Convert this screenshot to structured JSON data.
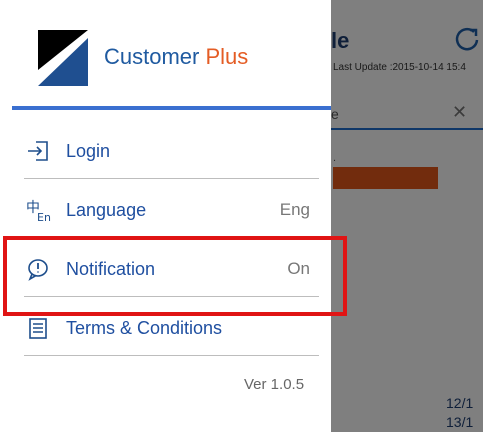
{
  "background": {
    "title": "le",
    "refresh_icon": "refresh-icon",
    "last_update": "Last Update :2015-10-14 15:4",
    "search_placeholder": "e",
    "close_icon": "close-icon",
    "dot_text": ".",
    "dates": [
      "12/1",
      "13/1"
    ]
  },
  "drawer": {
    "brand_name": "Customer ",
    "brand_plus": "Plus",
    "menu": [
      {
        "label": "Login",
        "icon": "login-icon",
        "value": ""
      },
      {
        "label": "Language",
        "icon": "language-icon",
        "value": "Eng"
      },
      {
        "label": "Notification",
        "icon": "notification-icon",
        "value": "On"
      },
      {
        "label": "Terms & Conditions",
        "icon": "document-icon",
        "value": ""
      }
    ],
    "version": "Ver 1.0.5"
  },
  "colors": {
    "brand_blue": "#1f5aa0",
    "brand_orange": "#e45c24",
    "highlight_red": "#e01414"
  }
}
